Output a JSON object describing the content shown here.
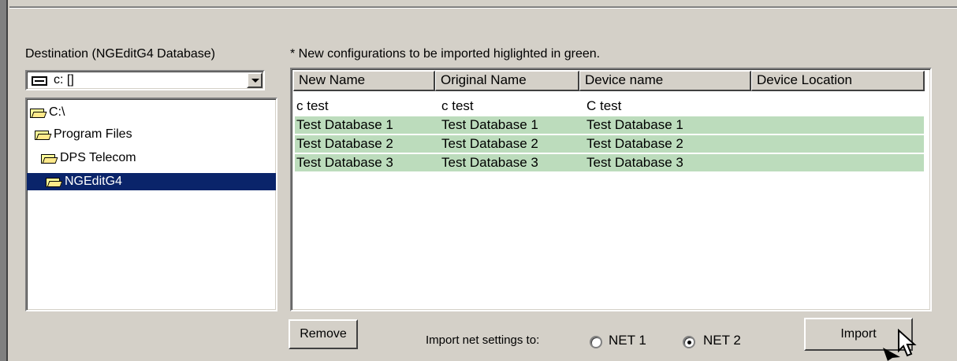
{
  "destination": {
    "label": "Destination (NGEditG4 Database)",
    "drive_value": "c: []",
    "folders": [
      {
        "name": "C:\\",
        "icon": "open-folder-icon"
      },
      {
        "name": "Program Files",
        "icon": "open-folder-icon"
      },
      {
        "name": "DPS Telecom",
        "icon": "open-folder-icon"
      },
      {
        "name": "NGEditG4",
        "icon": "open-folder-icon",
        "selected": true
      }
    ]
  },
  "note": "* New configurations to be imported higlighted in green.",
  "table": {
    "columns": [
      "New Name",
      "Original Name",
      "Device name",
      "Device Location"
    ],
    "rows": [
      {
        "cells": [
          "c test",
          "c test",
          "C test",
          ""
        ],
        "highlight": false
      },
      {
        "cells": [
          "Test Database 1",
          "Test Database 1",
          "Test Database 1",
          ""
        ],
        "highlight": true
      },
      {
        "cells": [
          "Test Database 2",
          "Test Database 2",
          "Test Database 2",
          ""
        ],
        "highlight": true
      },
      {
        "cells": [
          "Test Database 3",
          "Test Database 3",
          "Test Database 3",
          ""
        ],
        "highlight": true
      }
    ],
    "highlight_color": "#bcdcbc"
  },
  "footer": {
    "remove_label": "Remove",
    "import_net_label": "Import net settings to:",
    "net1_label": "NET 1",
    "net2_label": "NET 2",
    "selected_net": "NET 2",
    "import_label": "Import"
  }
}
